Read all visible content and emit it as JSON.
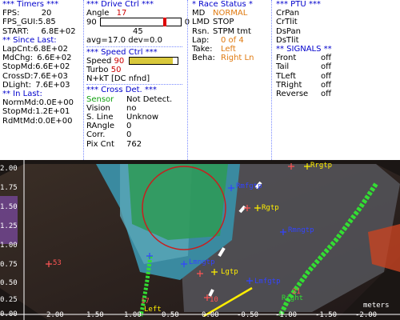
{
  "timers": {
    "title": "*** Timers ***",
    "fps_label": "FPS:",
    "fps": "20",
    "fps_gui_label": "FPS_GUI:",
    "fps_gui": "5.85",
    "start_label": "START:",
    "start": "6.8E+02",
    "since_title": "** Since Last:",
    "lapcnt_label": "LapCnt:",
    "lapcnt": "6.8E+02",
    "mdchg_label": "MdChg:",
    "mdchg": "6.6E+02",
    "stopmd_label": "StopMd:",
    "stopmd": "6.6E+02",
    "crossd_label": "CrossD:",
    "crossd": "7.6E+03",
    "dlight_label": "DLight:",
    "dlight": "7.6E+03",
    "inlast_title": "** In Last:",
    "normmd_label": "NormMd:",
    "normmd": "0.0E+00",
    "stopmd2_label": "StopMd:",
    "stopmd2": "1.2E+01",
    "rdmtmd_label": "RdMtMd:",
    "rdmtmd": "0.0E+00"
  },
  "drive": {
    "title": "***  Drive Ctrl  ***",
    "angle_label": "Angle",
    "angle": "17",
    "slider_left": "90",
    "slider_right": "0",
    "slider_value": 17,
    "slider_mid": "45",
    "avg": "avg=17.0",
    "dev": "dev=0.0",
    "speed_title": "***  Speed Ctrl  ***",
    "speed_label": "Speed",
    "speed": "90",
    "speed_bar": 0.9,
    "turbo_label": "Turbo",
    "turbo": "50",
    "nkt": "N+kT [DC nfnd]",
    "cross_title": "*** Cross Det. ***",
    "sensor_label": "Sensor",
    "sensor": "Not Detect.",
    "vision_label": "Vision",
    "vision": "no",
    "sline_label": "S. Line",
    "sline": "Unknow",
    "rangle_label": "RAngle",
    "rangle": "0",
    "corr_label": "Corr.",
    "corr": "0",
    "pixcnt_label": "Pix Cnt",
    "pixcnt": "762"
  },
  "race": {
    "title": "* Race Status *",
    "md_label": "MD",
    "md": "NORMAL",
    "lmd_label": "LMD",
    "lmd": "STOP",
    "rsn_label": "Rsn.",
    "rsn": "STPM tmt",
    "lap_label": "Lap:",
    "lap": "0 of 4",
    "take_label": "Take:",
    "take": "Left",
    "beha_label": "Beha:",
    "beha": "Right Ln"
  },
  "ptu": {
    "title": "*** PTU ***",
    "items": [
      "CrPan",
      "CrTlit",
      "DsPan",
      "DsTlit"
    ],
    "signals_title": "** SIGNALS **",
    "signals": [
      {
        "name": "Front",
        "state": "off"
      },
      {
        "name": "Tail",
        "state": "off"
      },
      {
        "name": "TLeft",
        "state": "off"
      },
      {
        "name": "TRight",
        "state": "off"
      },
      {
        "name": "Reverse",
        "state": "off"
      }
    ]
  },
  "camera": {
    "yticks": [
      "2.00",
      "1.75",
      "1.50",
      "1.25",
      "1.00",
      "0.75",
      "0.50",
      "0.25",
      "0.00"
    ],
    "xticks": [
      "2.00",
      "1.50",
      "1.00",
      "0.50",
      "0.00",
      "-0.50",
      "-1.00",
      "-1.50",
      "-2.00"
    ],
    "unit": "meters",
    "markers": {
      "rrgtp": "Rrgtp",
      "rmfgtp": "Rmfgtp",
      "rgtp": "Rgtp",
      "rmngtp": "Rmngtp",
      "lmngtp": "Lmngtp",
      "lgtp": "Lgtp",
      "lmfgtp": "Lmfgtp",
      "num53": "53",
      "num17": "17",
      "num21": "21",
      "num10": "10",
      "left": "Left",
      "right": "Right"
    }
  }
}
